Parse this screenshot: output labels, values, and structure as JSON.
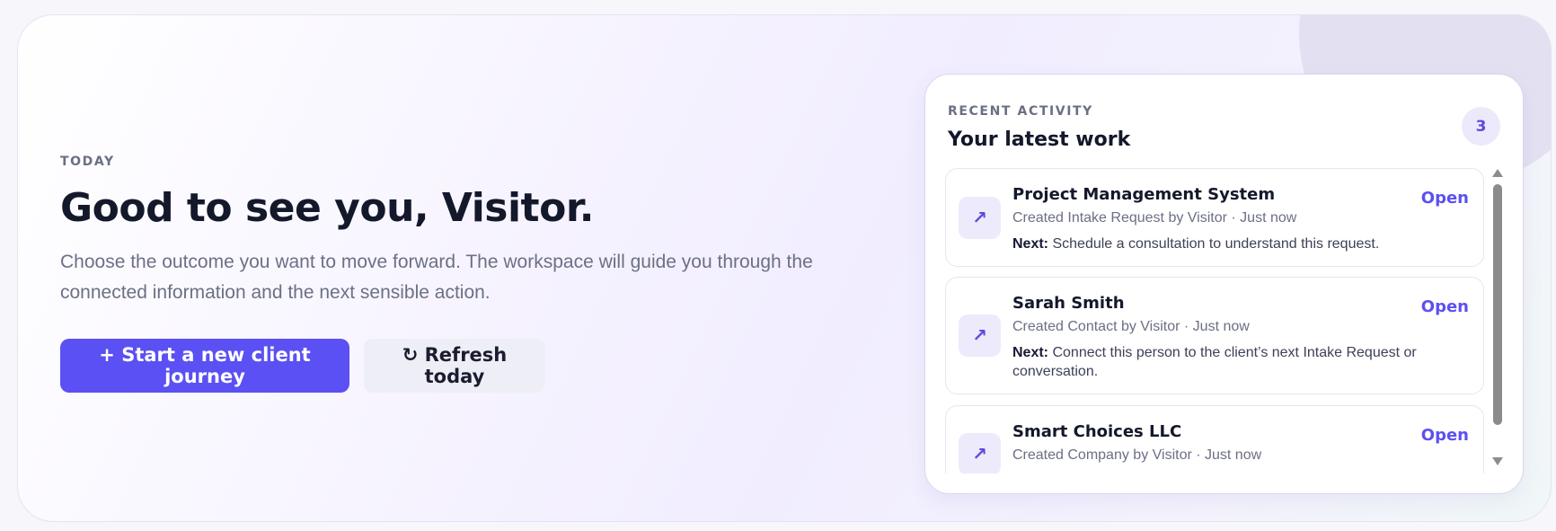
{
  "hero": {
    "eyebrow": "TODAY",
    "headline": "Good to see you, Visitor.",
    "lede": "Choose the outcome you want to move forward. The workspace will guide you through the connected information and the next sensible action.",
    "primary_button": "+ Start a new client journey",
    "secondary_button": "↻ Refresh today"
  },
  "activity": {
    "eyebrow": "RECENT ACTIVITY",
    "title": "Your latest work",
    "count": "3",
    "items": [
      {
        "icon": "↗",
        "title": "Project Management System",
        "meta": "Created Intake Request by Visitor · Just now",
        "next_label": "Next:",
        "next_text": "Schedule a consultation to understand this request.",
        "action": "Open"
      },
      {
        "icon": "↗",
        "title": "Sarah Smith",
        "meta": "Created Contact by Visitor · Just now",
        "next_label": "Next:",
        "next_text": "Connect this person to the client’s next Intake Request or conversation.",
        "action": "Open"
      },
      {
        "icon": "↗",
        "title": "Smart Choices LLC",
        "meta": "Created Company by Visitor · Just now",
        "action": "Open"
      }
    ]
  },
  "colors": {
    "accent": "#5b50f3",
    "panel_border": "#d9d6ef"
  }
}
